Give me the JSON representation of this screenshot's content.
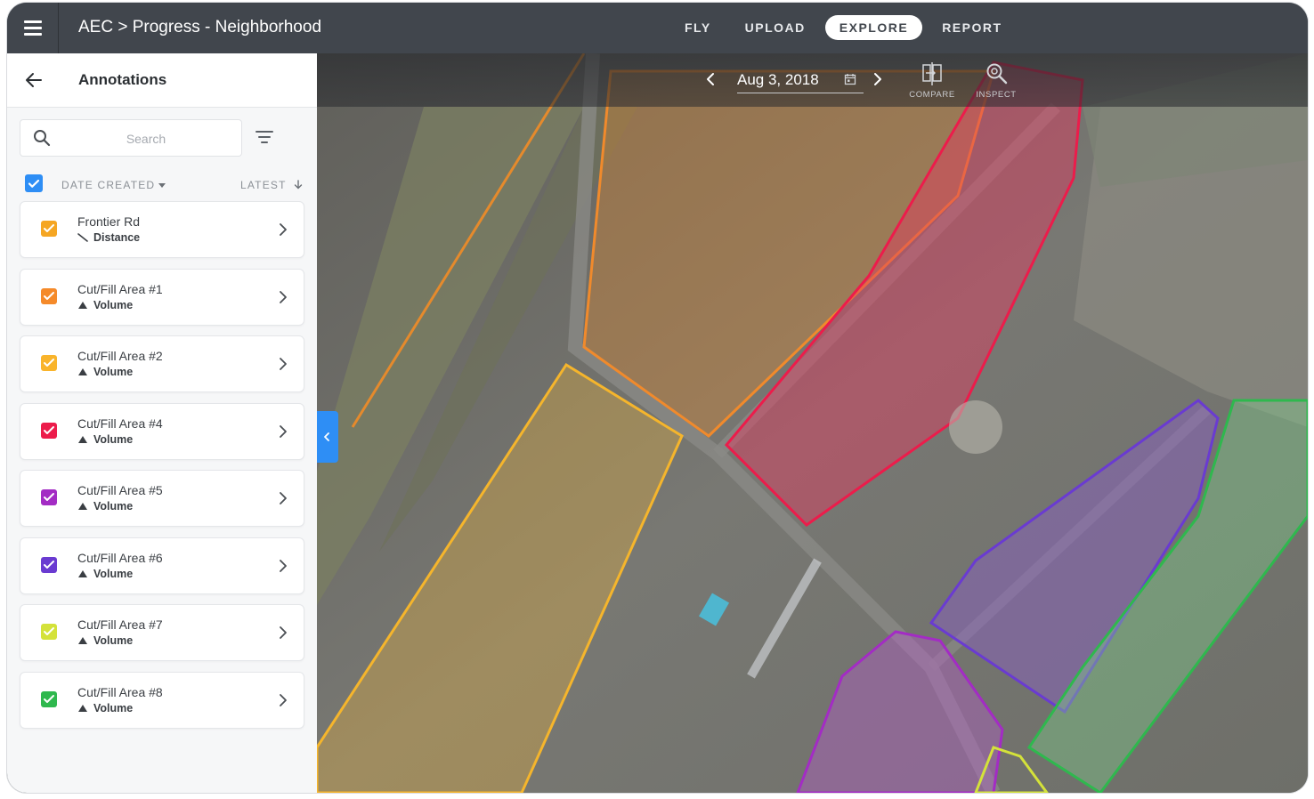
{
  "app": {
    "title": "AEC > Progress - Neighborhood"
  },
  "nav": {
    "items": [
      {
        "label": "FLY",
        "active": false
      },
      {
        "label": "UPLOAD",
        "active": false
      },
      {
        "label": "EXPLORE",
        "active": true
      },
      {
        "label": "REPORT",
        "active": false
      }
    ]
  },
  "sidebar": {
    "title": "Annotations",
    "search": {
      "placeholder": "Search",
      "value": ""
    },
    "sort": {
      "label": "DATE CREATED",
      "order": "LATEST"
    },
    "items": [
      {
        "name": "Frontier Rd",
        "type": "Distance",
        "type_icon": "line-icon",
        "color": "#f5a623"
      },
      {
        "name": "Cut/Fill Area #1",
        "type": "Volume",
        "type_icon": "volume-icon",
        "color": "#f58a2a"
      },
      {
        "name": "Cut/Fill Area #2",
        "type": "Volume",
        "type_icon": "volume-icon",
        "color": "#f9b42b"
      },
      {
        "name": "Cut/Fill Area #4",
        "type": "Volume",
        "type_icon": "volume-icon",
        "color": "#ec1c4b"
      },
      {
        "name": "Cut/Fill Area #5",
        "type": "Volume",
        "type_icon": "volume-icon",
        "color": "#a32cc4"
      },
      {
        "name": "Cut/Fill Area #6",
        "type": "Volume",
        "type_icon": "volume-icon",
        "color": "#6a3bd1"
      },
      {
        "name": "Cut/Fill Area #7",
        "type": "Volume",
        "type_icon": "volume-icon",
        "color": "#d4e23a"
      },
      {
        "name": "Cut/Fill Area #8",
        "type": "Volume",
        "type_icon": "volume-icon",
        "color": "#2fb84e"
      }
    ]
  },
  "map": {
    "date": "Aug 3, 2018",
    "tools": [
      {
        "label": "COMPARE",
        "icon": "compare-icon"
      },
      {
        "label": "INSPECT",
        "icon": "inspect-icon"
      }
    ]
  },
  "colors": {
    "accent": "#2e8ef5",
    "topbar": "#41464d"
  }
}
